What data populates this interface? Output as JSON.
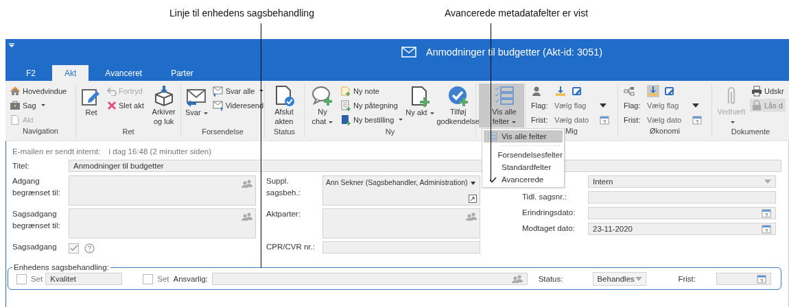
{
  "annotations": [
    {
      "text": "Linje til enhedens sagsbehandling"
    },
    {
      "text": "Avancerede metadatafelter er vist"
    }
  ],
  "window": {
    "title": "Anmodninger til budgetter (Akt-id: 3051)"
  },
  "tabs": [
    {
      "label": "F2",
      "selected": false
    },
    {
      "label": "Akt",
      "selected": true
    },
    {
      "label": "Avanceret",
      "selected": false
    },
    {
      "label": "Parter",
      "selected": false
    }
  ],
  "ribbon": [
    {
      "label": "Navigation",
      "kind": "buttons",
      "items": [
        {
          "label": "Hovedvindue",
          "kind": "small",
          "disabled": false,
          "dropdown": false,
          "pressed": false
        },
        {
          "label": "Sag",
          "kind": "small",
          "disabled": false,
          "dropdown": true,
          "pressed": false
        },
        {
          "label": "Akt",
          "kind": "small",
          "disabled": true,
          "dropdown": false,
          "pressed": false
        }
      ]
    },
    {
      "label": "Ret",
      "kind": "buttons",
      "items": [
        {
          "label": "Ret",
          "kind": "large",
          "disabled": false,
          "dropdown": false,
          "pressed": false
        },
        {
          "label": "Fortryd",
          "kind": "small",
          "disabled": true,
          "dropdown": false,
          "pressed": false
        },
        {
          "label": "Slet akt",
          "kind": "small",
          "disabled": false,
          "dropdown": false,
          "pressed": false
        },
        {
          "label": "Arkiver og luk",
          "kind": "large",
          "disabled": false,
          "dropdown": false,
          "pressed": false
        }
      ]
    },
    {
      "label": "Forsendelse",
      "kind": "buttons",
      "items": [
        {
          "label": "Svar",
          "kind": "large",
          "disabled": false,
          "dropdown": true,
          "pressed": false
        },
        {
          "label": "Svar alle",
          "kind": "small",
          "disabled": false,
          "dropdown": true,
          "pressed": false
        },
        {
          "label": "Videresend",
          "kind": "small",
          "disabled": false,
          "dropdown": false,
          "pressed": false
        }
      ]
    },
    {
      "label": "Status",
      "kind": "buttons",
      "items": [
        {
          "label": "Afslut akten",
          "kind": "large",
          "disabled": false,
          "dropdown": false,
          "pressed": false
        }
      ]
    },
    {
      "label": "Ny",
      "kind": "buttons",
      "items": [
        {
          "label": "Ny chat",
          "kind": "large",
          "disabled": false,
          "dropdown": true,
          "pressed": false
        },
        {
          "label": "Ny note",
          "kind": "small",
          "disabled": false,
          "dropdown": false,
          "pressed": false
        },
        {
          "label": "Ny påtegning",
          "kind": "small",
          "disabled": false,
          "dropdown": false,
          "pressed": false
        },
        {
          "label": "Ny bestilling",
          "kind": "small",
          "disabled": false,
          "dropdown": true,
          "pressed": false
        },
        {
          "label": "Ny akt",
          "kind": "large",
          "disabled": false,
          "dropdown": true,
          "pressed": false
        },
        {
          "label": "Tilføj godkendelse",
          "kind": "large",
          "disabled": false,
          "dropdown": false,
          "pressed": false
        }
      ]
    },
    {
      "kind": "buttons",
      "items": [
        {
          "label": "Vis alle felter",
          "kind": "large",
          "disabled": false,
          "dropdown": true,
          "pressed": true
        }
      ]
    },
    {
      "label": "Mig",
      "kind": "flags",
      "download_active": false,
      "flag_label": "Flag:",
      "flag_value": "Vælg flag",
      "date_label": "Frist:",
      "date_value": "Vælg dato"
    },
    {
      "label": "Økonomi",
      "kind": "flags",
      "download_active": true,
      "flag_label": "Flag:",
      "flag_value": "Vælg flag",
      "date_label": "Frist:",
      "date_value": "Vælg dato"
    },
    {
      "label": "Dokumente",
      "kind": "buttons",
      "items": [
        {
          "label": "Vedhæft",
          "kind": "large",
          "disabled": true,
          "dropdown": true,
          "pressed": false
        },
        {
          "label": "Udskr",
          "kind": "small",
          "disabled": false,
          "dropdown": false,
          "pressed": false
        },
        {
          "label": "Lås d",
          "kind": "small",
          "disabled": true,
          "dropdown": false,
          "pressed": true
        }
      ]
    }
  ],
  "menu": {
    "items": [
      {
        "label": "Vis alle felter",
        "kind": "command",
        "highlighted": true,
        "checked": false
      },
      {
        "label": "Forsendelsesfelter",
        "kind": "option",
        "highlighted": false,
        "checked": false
      },
      {
        "label": "Standardfelter",
        "kind": "option",
        "highlighted": false,
        "checked": false
      },
      {
        "label": "Avancerede",
        "kind": "option",
        "highlighted": false,
        "checked": true
      }
    ]
  },
  "info": {
    "label": "E-mailen er sendt internt:",
    "value": "i dag 16:48 (2 minutter siden)"
  },
  "title_field": {
    "label": "Titel:",
    "value": "Anmodninger til budgetter"
  },
  "columns": [
    [
      {
        "label": "Adgang begrænset til:",
        "kind": "people"
      },
      {
        "label": "Sagsadgang begrænset til:",
        "kind": "people"
      },
      {
        "label": "Sagsadgang",
        "kind": "checkbox",
        "checked": true
      }
    ],
    [
      {
        "label": "Suppl. sagsbeh.:",
        "kind": "select-people",
        "value": "Ann Sekner (Sagsbehandler, Administration)"
      },
      {
        "label": "Aktparter:",
        "kind": "people"
      },
      {
        "label": "CPR/CVR nr.:",
        "kind": "text"
      }
    ],
    [
      {
        "kind": "select",
        "value": "Intern"
      },
      {
        "label": "Tidl. sagsnr.:",
        "kind": "text"
      },
      {
        "label": "Erindringsdato:",
        "kind": "date"
      },
      {
        "label": "Modtaget dato:",
        "kind": "date",
        "value": "23-11-2020"
      }
    ]
  ],
  "case_handling": {
    "legend": "Enhedens sagsbehandling:",
    "items": [
      {
        "kind": "check",
        "label": "Set",
        "checked": false
      },
      {
        "kind": "text",
        "value": "Kvalitet"
      },
      {
        "kind": "check",
        "label": "Set",
        "checked": false
      },
      {
        "kind": "label",
        "text": "Ansvarlig:"
      },
      {
        "kind": "people"
      },
      {
        "kind": "label",
        "text": "Status:"
      },
      {
        "kind": "select",
        "value": "Behandles"
      },
      {
        "kind": "label",
        "text": "Frist:"
      },
      {
        "kind": "date"
      }
    ]
  }
}
